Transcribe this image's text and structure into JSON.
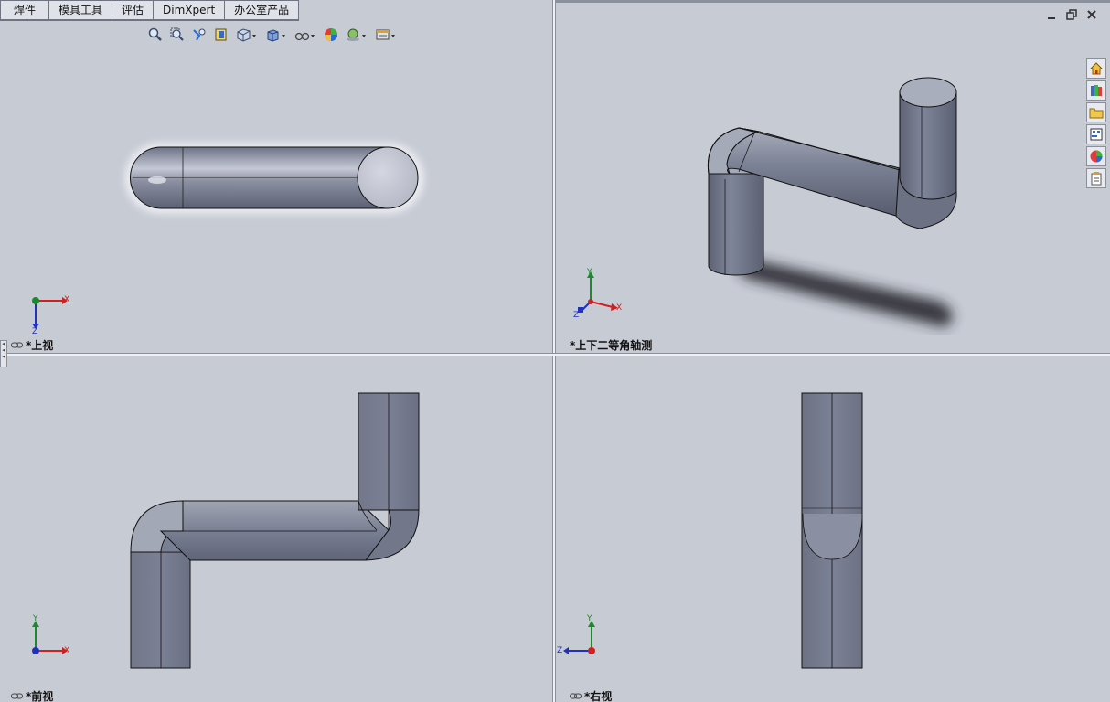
{
  "tabs": [
    "焊件",
    "模具工具",
    "评估",
    "DimXpert",
    "办公室产品"
  ],
  "views": {
    "top": "*上视",
    "iso": "*上下二等角轴测",
    "front": "*前视",
    "right": "*右视"
  },
  "axes": {
    "x": "X",
    "y": "Y",
    "z": "Z"
  },
  "hud_icons": [
    "zoom-to-fit-icon",
    "zoom-area-icon",
    "previous-view-icon",
    "section-view-icon",
    "view-orientation-icon",
    "display-style-icon",
    "hide-show-items-icon",
    "edit-appearance-icon",
    "apply-scene-icon",
    "view-settings-icon"
  ],
  "window_controls": [
    "minimize-icon",
    "restore-icon",
    "close-icon"
  ],
  "task_pane": [
    "home-icon",
    "design-library-icon",
    "file-explorer-icon",
    "view-palette-icon",
    "appearances-icon",
    "custom-properties-icon"
  ],
  "colors": {
    "part_dark": "#5a5f70",
    "part_mid": "#7b8194",
    "part_light": "#b9bdcb",
    "background": "#c7cbd4"
  }
}
